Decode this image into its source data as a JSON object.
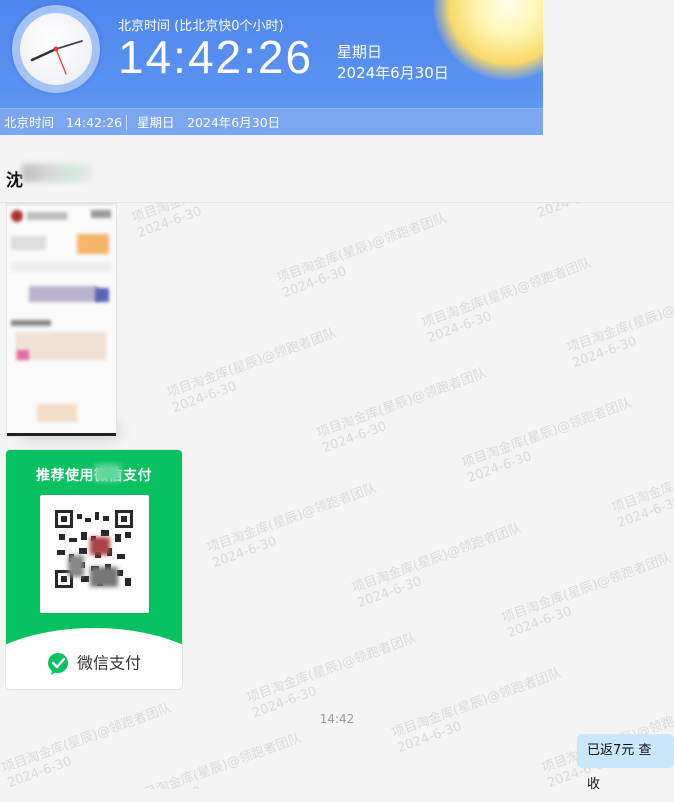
{
  "time_widget": {
    "subtitle": "北京时间 (比北京快0个小时)",
    "time": "14:42:26",
    "weekday": "星期日",
    "date": "2024年6月30日",
    "info_bar": {
      "label": "北京时间",
      "time": "14:42:26",
      "weekday": "星期日",
      "date": "2024年6月30日"
    }
  },
  "chat": {
    "contact_name_visible": "沈",
    "watermark": {
      "line1": "项目淘金库(星辰)@领跑者团队",
      "line2": "2024-6-30"
    },
    "payment_card": {
      "title": "推荐使用微信支付",
      "footer": "微信支付"
    },
    "timestamp": "14:42",
    "message_bubble": "已返7元 查收"
  },
  "colors": {
    "widget_blue": "#4f86ee",
    "wechat_green": "#08c160",
    "bubble_blue": "#c9e6fb"
  },
  "icons": [
    "clock-icon",
    "wechat-pay-icon"
  ]
}
